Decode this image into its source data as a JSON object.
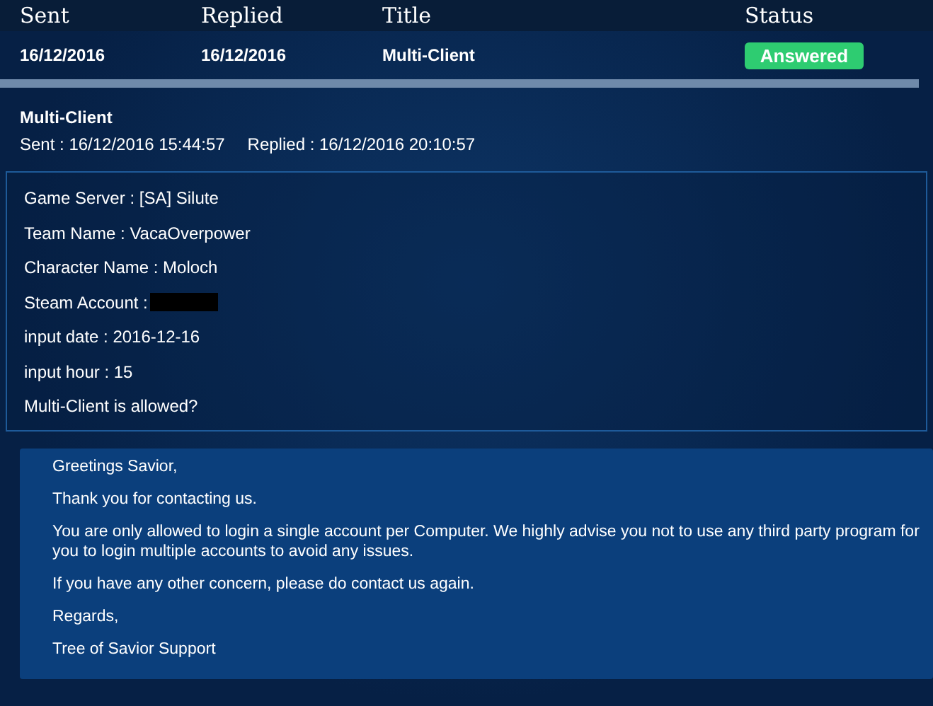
{
  "table": {
    "columns": [
      "Sent",
      "Replied",
      "Title",
      "Status"
    ],
    "rows": [
      {
        "sent": "16/12/2016",
        "replied": "16/12/2016",
        "title": "Multi-Client",
        "status": {
          "label": "Answered",
          "kind": "answered"
        }
      }
    ]
  },
  "ticket": {
    "title": "Multi-Client",
    "sent": "Sent : 16/12/2016 15:44:57",
    "replied": "Replied : 16/12/2016 20:10:57",
    "fields": [
      {
        "text": "Game Server : [SA] Silute",
        "redacted": false
      },
      {
        "text": "Team Name : VacaOverpower",
        "redacted": false
      },
      {
        "text": "Character Name : Moloch",
        "redacted": false
      },
      {
        "text": "Steam Account :",
        "redacted": true
      },
      {
        "text": "input date : 2016-12-16",
        "redacted": false
      },
      {
        "text": "input hour : 15",
        "redacted": false
      },
      {
        "text": "Multi-Client is allowed?",
        "redacted": false
      }
    ]
  },
  "reply": [
    "Greetings Savior,",
    "Thank you for contacting us.",
    "You are only allowed to login a single account per Computer. We highly advise you not to use any third party program for you to login multiple accounts to avoid any issues.",
    "If you have any other concern, please do contact us again.",
    "Regards,",
    "Tree of Savior Support"
  ]
}
